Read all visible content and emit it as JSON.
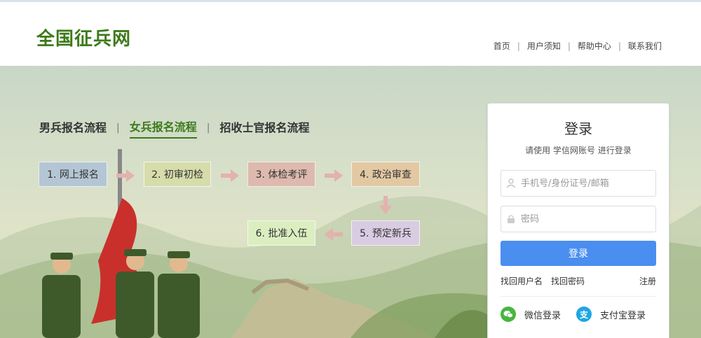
{
  "header": {
    "logo": "全国征兵网",
    "nav": [
      "首页",
      "用户须知",
      "帮助中心",
      "联系我们"
    ]
  },
  "process": {
    "tabs": [
      "男兵报名流程",
      "女兵报名流程",
      "招收士官报名流程"
    ],
    "active_tab": 1,
    "steps": [
      {
        "label": "1. 网上报名",
        "color": "#b4c6d4"
      },
      {
        "label": "2. 初审初检",
        "color": "#d6dcaa"
      },
      {
        "label": "3. 体检考评",
        "color": "#ddb9ae"
      },
      {
        "label": "4. 政治审查",
        "color": "#e2c9a4"
      },
      {
        "label": "5. 预定新兵",
        "color": "#d9cbe2"
      },
      {
        "label": "6. 批准入伍",
        "color": "#dbeec0"
      }
    ],
    "arrow_color": "#e3b1ae"
  },
  "login": {
    "title": "登录",
    "subtitle": "请使用 学信网账号 进行登录",
    "username_placeholder": "手机号/身份证号/邮箱",
    "password_placeholder": "密码",
    "submit_label": "登录",
    "find_username": "找回用户名",
    "find_password": "找回密码",
    "register": "注册",
    "wechat_label": "微信登录",
    "alipay_label": "支付宝登录",
    "alipay_glyph": "支",
    "button_color": "#4a8ef0"
  }
}
